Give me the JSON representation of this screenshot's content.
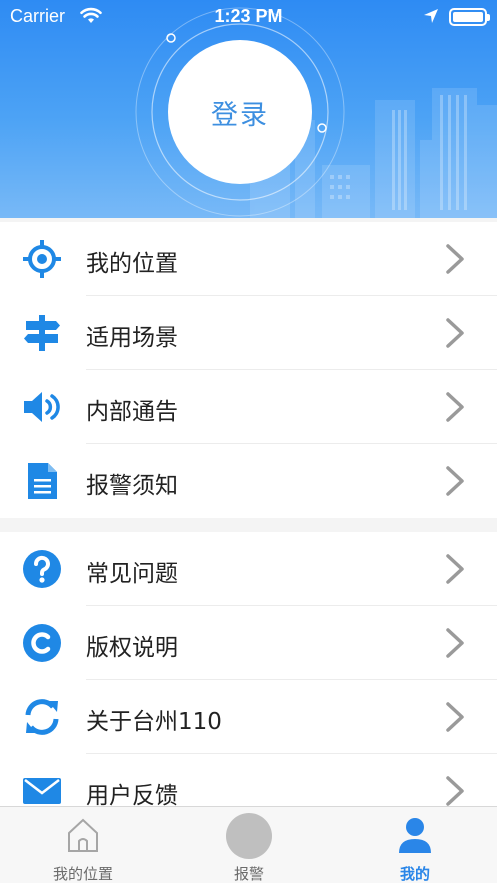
{
  "status_bar": {
    "carrier": "Carrier",
    "time": "1:23 PM"
  },
  "header": {
    "login_label": "登录",
    "background_color": "#3d94f4"
  },
  "menu": {
    "group1": [
      {
        "label": "我的位置",
        "icon": "location-target-icon"
      },
      {
        "label": "适用场景",
        "icon": "signpost-icon"
      },
      {
        "label": "内部通告",
        "icon": "speaker-icon"
      },
      {
        "label": "报警须知",
        "icon": "document-icon"
      }
    ],
    "group2": [
      {
        "label": "常见问题",
        "icon": "question-icon"
      },
      {
        "label": "版权说明",
        "icon": "copyright-icon"
      },
      {
        "label": "关于台州110",
        "icon": "refresh-icon"
      },
      {
        "label": "用户反馈",
        "icon": "mail-icon"
      }
    ]
  },
  "tabbar": {
    "tabs": [
      {
        "label": "我的位置",
        "icon": "home-icon",
        "active": false
      },
      {
        "label": "报警",
        "icon": "alarm-button-icon",
        "active": false
      },
      {
        "label": "我的",
        "icon": "user-icon",
        "active": true
      }
    ]
  },
  "colors": {
    "accent": "#2a86e8",
    "icon_blue": "#1f88e5",
    "chevron": "#9a9a9a"
  }
}
